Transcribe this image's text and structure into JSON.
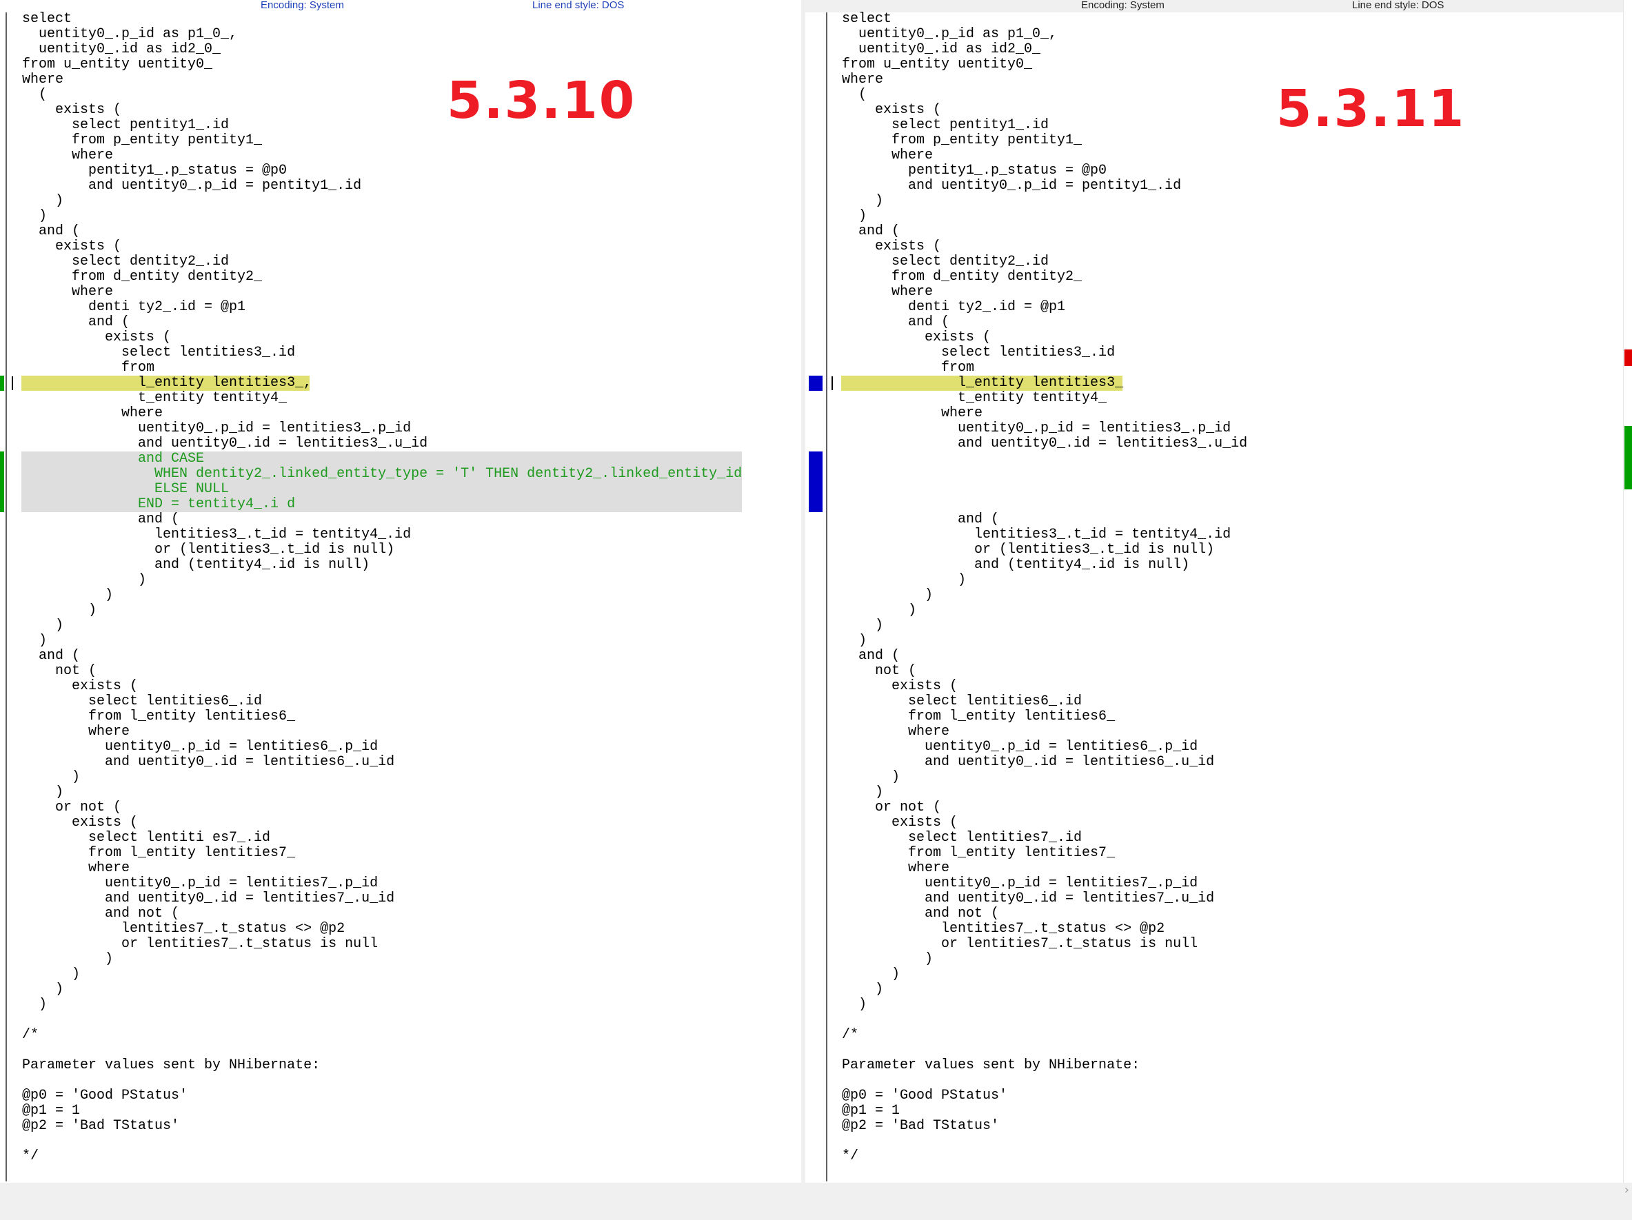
{
  "left_pane": {
    "version_label": "5.3.10",
    "header": {
      "encoding": "Encoding: System",
      "line_end_style": "Line end style: DOS"
    },
    "lines": [
      "select",
      "  uentity0_.p_id as p1_0_,",
      "  uentity0_.id as id2_0_",
      "from u_entity uentity0_",
      "where",
      "  (",
      "    exists (",
      "      select pentity1_.id",
      "      from p_entity pentity1_",
      "      where",
      "        pentity1_.p_status = @p0",
      "        and uentity0_.p_id = pentity1_.id",
      "    )",
      "  )",
      "  and (",
      "    exists (",
      "      select dentity2_.id",
      "      from d_entity dentity2_",
      "      where",
      "        denti ty2_.id = @p1",
      "        and (",
      "          exists (",
      "            select lentities3_.id",
      "            from",
      "              l_entity lentities3_,",
      "              t_entity tentity4_",
      "            where",
      "              uentity0_.p_id = lentities3_.p_id",
      "              and uentity0_.id = lentities3_.u_id",
      "              and CASE",
      "                WHEN dentity2_.linked_entity_type = 'T' THEN dentity2_.linked_entity_id",
      "                ELSE NULL",
      "              END = tentity4_.i d",
      "              and (",
      "                lentities3_.t_id = tentity4_.id",
      "                or (lentities3_.t_id is null)",
      "                and (tentity4_.id is null)",
      "              )",
      "          )",
      "        )",
      "    )",
      "  )",
      "  and (",
      "    not (",
      "      exists (",
      "        select lentities6_.id",
      "        from l_entity lentities6_",
      "        where",
      "          uentity0_.p_id = lentities6_.p_id",
      "          and uentity0_.id = lentities6_.u_id",
      "      )",
      "    )",
      "    or not (",
      "      exists (",
      "        select lentiti es7_.id",
      "        from l_entity lentities7_",
      "        where",
      "          uentity0_.p_id = lentities7_.p_id",
      "          and uentity0_.id = lentities7_.u_id",
      "          and not (",
      "            lentities7_.t_status <> @p2",
      "            or lentities7_.t_status is null",
      "          )",
      "      )",
      "    )",
      "  )",
      "",
      "/*",
      "",
      "Parameter values sent by NHibernate:",
      "",
      "@p0 = 'Good PStatus'",
      "@p1 = 1",
      "@p2 = 'Bad TStatus'",
      "",
      "*/"
    ]
  },
  "right_pane": {
    "version_label": "5.3.11",
    "header": {
      "encoding": "Encoding: System",
      "line_end_style": "Line end style: DOS"
    },
    "lines": [
      "select",
      "  uentity0_.p_id as p1_0_,",
      "  uentity0_.id as id2_0_",
      "from u_entity uentity0_",
      "where",
      "  (",
      "    exists (",
      "      select pentity1_.id",
      "      from p_entity pentity1_",
      "      where",
      "        pentity1_.p_status = @p0",
      "        and uentity0_.p_id = pentity1_.id",
      "    )",
      "  )",
      "  and (",
      "    exists (",
      "      select dentity2_.id",
      "      from d_entity dentity2_",
      "      where",
      "        denti ty2_.id = @p1",
      "        and (",
      "          exists (",
      "            select lentities3_.id",
      "            from",
      "              l_entity lentities3_",
      "              t_entity tentity4_",
      "            where",
      "              uentity0_.p_id = lentities3_.p_id",
      "              and uentity0_.id = lentities3_.u_id",
      "",
      "",
      "",
      "",
      "              and (",
      "                lentities3_.t_id = tentity4_.id",
      "                or (lentities3_.t_id is null)",
      "                and (tentity4_.id is null)",
      "              )",
      "          )",
      "        )",
      "    )",
      "  )",
      "  and (",
      "    not (",
      "      exists (",
      "        select lentities6_.id",
      "        from l_entity lentities6_",
      "        where",
      "          uentity0_.p_id = lentities6_.p_id",
      "          and uentity0_.id = lentities6_.u_id",
      "      )",
      "    )",
      "    or not (",
      "      exists (",
      "        select lentities7_.id",
      "        from l_entity lentities7_",
      "        where",
      "          uentity0_.p_id = lentities7_.p_id",
      "          and uentity0_.id = lentities7_.u_id",
      "          and not (",
      "            lentities7_.t_status <> @p2",
      "            or lentities7_.t_status is null",
      "          )",
      "      )",
      "    )",
      "  )",
      "",
      "/*",
      "",
      "Parameter values sent by NHibernate:",
      "",
      "@p0 = 'Good PStatus'",
      "@p1 = 1",
      "@p2 = 'Bad TStatus'",
      "",
      "*/"
    ]
  },
  "statusbar": {
    "chevron_icon": "chevron-right-icon",
    "chevron": "›"
  },
  "colors": {
    "version_label": "#ee1c25",
    "changed_text": "#1e9a1e",
    "line_highlight": "#e0e070",
    "block_highlight": "#dedede",
    "marker_blue": "#0000c8",
    "marker_green": "#00a000",
    "overview_red": "#e00000"
  }
}
